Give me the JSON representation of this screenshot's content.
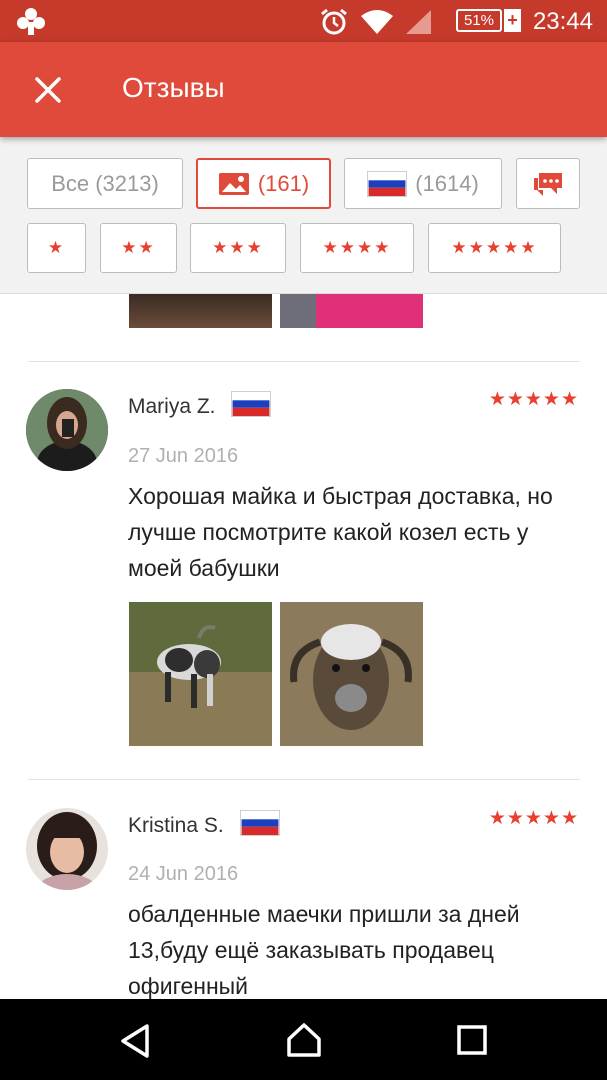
{
  "status_bar": {
    "battery": "51%",
    "time": "23:44",
    "icons": [
      "app-notification-icon",
      "alarm-icon",
      "wifi-icon",
      "cellular-signal-icon",
      "battery-icon"
    ]
  },
  "app_bar": {
    "title": "Отзывы",
    "close_icon": "close-icon"
  },
  "filters": {
    "all": "Все (3213)",
    "photos_count": "(161)",
    "country_count": "(1614)",
    "star_chips": [
      "★",
      "★★",
      "★★★",
      "★★★★",
      "★★★★★"
    ]
  },
  "reviews": [
    {
      "name": "Mariya Z.",
      "date": "27 Jun 2016",
      "rating_stars": "★★★★★",
      "rating": 5,
      "text": "Хорошая майка и быстрая доставка, но лучше посмотрите какой козел есть у моей бабушки"
    },
    {
      "name": "Kristina S.",
      "date": "24 Jun 2016",
      "rating_stars": "★★★★★",
      "rating": 5,
      "text": "обалденные маечки пришли за дней 13,буду ещё заказывать продавец офигенный"
    }
  ],
  "colors": {
    "status_bar": "#c63a2c",
    "app_bar": "#e04a3a",
    "accent_star": "#e8402f"
  },
  "nav_bar": {
    "icons": [
      "back-icon",
      "home-icon",
      "recents-icon"
    ]
  }
}
